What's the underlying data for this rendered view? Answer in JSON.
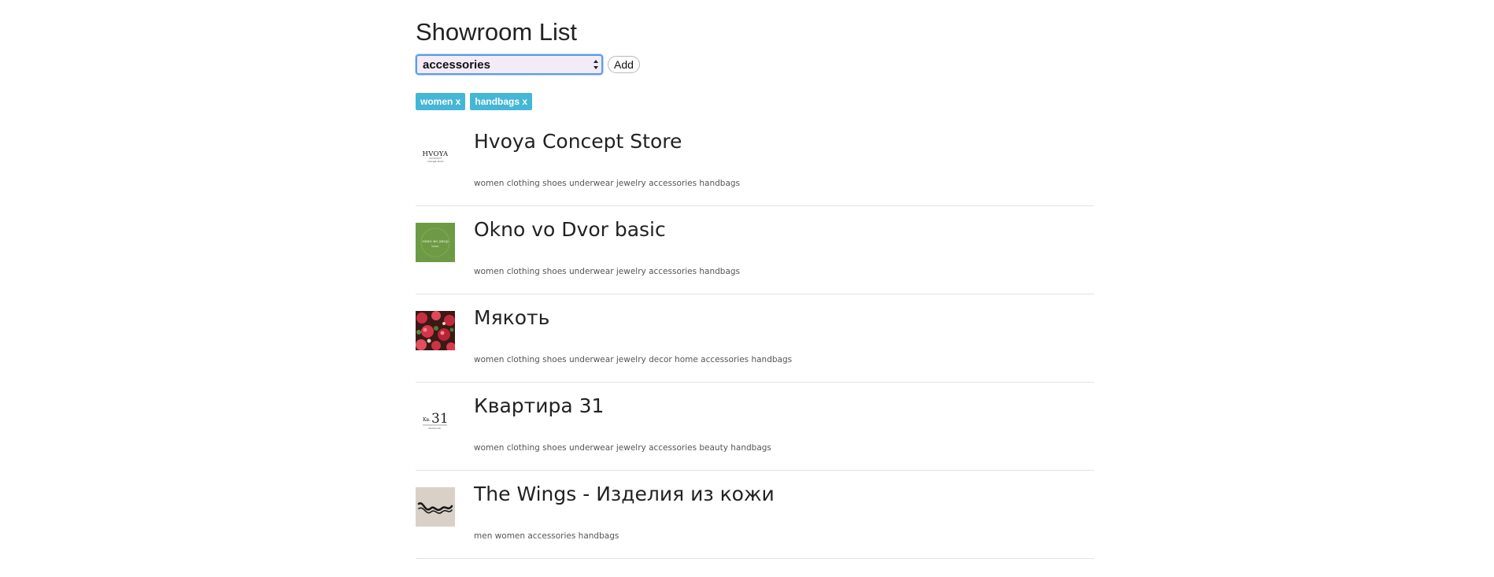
{
  "page": {
    "title": "Showroom List"
  },
  "filter": {
    "selected_category": "accessories",
    "add_label": "Add"
  },
  "active_tags": [
    {
      "label": "women x"
    },
    {
      "label": "handbags x"
    }
  ],
  "showrooms": [
    {
      "name": "Hvoya Concept Store",
      "categories": "women clothing shoes underwear jewelry accessories handbags",
      "logo": {
        "icon": "hvoya-logo-icon",
        "text": "HVOYA",
        "subtext": "concept store",
        "bg": "#ffffff",
        "fg": "#111111"
      }
    },
    {
      "name": "Okno vo Dvor basic",
      "categories": "women clothing shoes underwear jewelry accessories handbags",
      "logo": {
        "icon": "okno-vo-dvor-logo-icon",
        "text": "окно во двор",
        "subtext": "basic",
        "bg": "#6e9a45",
        "fg": "#e6f0d8"
      }
    },
    {
      "name": "Мякоть",
      "categories": "women clothing shoes underwear jewelry decor home accessories handbags",
      "logo": {
        "icon": "floral-pattern-logo-icon",
        "bg": "#3a1a14",
        "fg": "#d8344a"
      }
    },
    {
      "name": "Квартира 31",
      "categories": "women clothing shoes underwear jewelry accessories beauty handbags",
      "logo": {
        "icon": "kv31-logo-icon",
        "text": "Кв.31",
        "subtext": "showroom",
        "bg": "#ffffff",
        "fg": "#222222"
      }
    },
    {
      "name": "The Wings - Изделия из кожи",
      "categories": "men women accessories handbags",
      "logo": {
        "icon": "wings-logo-icon",
        "bg": "#d9d1c7",
        "fg": "#1a1a1a"
      }
    }
  ],
  "colors": {
    "tag_bg": "#45b6d6",
    "select_border": "#5b9dea",
    "divider": "#e3e3e3"
  }
}
